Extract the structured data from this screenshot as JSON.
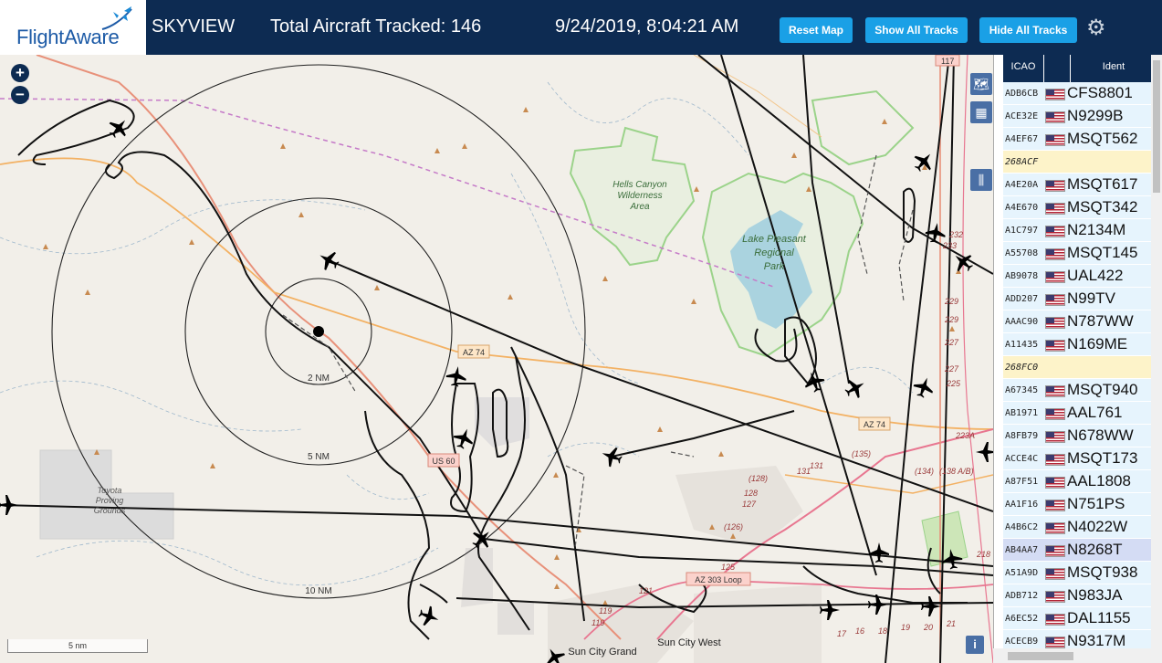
{
  "header": {
    "logo_text": "FlightAware",
    "app_name": "SKYVIEW",
    "aircraft_tracked": "Total Aircraft Tracked: 146",
    "datetime": "9/24/2019, 8:04:21 AM",
    "buttons": {
      "reset_map": "Reset Map",
      "show_all_tracks": "Show All Tracks",
      "hide_all_tracks": "Hide All Tracks"
    }
  },
  "map": {
    "zoom_in": "+",
    "zoom_out": "−",
    "range_rings": [
      "2 NM",
      "5 NM",
      "10 NM"
    ],
    "scale_label": "5 nm",
    "info": "i",
    "labels": {
      "hells_canyon": [
        "Hells Canyon",
        "Wilderness",
        "Area"
      ],
      "lake_pleasant": [
        "Lake Pleasant",
        "Regional",
        "Park"
      ],
      "toyota": [
        "Toyota",
        "Proving",
        "Grounds"
      ],
      "sun_city_grand": "Sun City Grand",
      "sun_city_west": "Sun City West",
      "road_az74_a": "AZ 74",
      "road_az74_b": "AZ 74",
      "road_us60": "US 60",
      "road_az303": "AZ 303 Loop",
      "nums": [
        "229",
        "229",
        "227",
        "227",
        "225",
        "223A",
        "(135)",
        "(134)",
        "(138 A/B)",
        "131",
        "131",
        "(128)",
        "128",
        "127",
        "(126)",
        "125",
        "121",
        "119",
        "119",
        "17",
        "16",
        "18",
        "19",
        "20",
        "21",
        "218",
        "232",
        "233",
        "117"
      ]
    }
  },
  "table": {
    "headers": {
      "icao": "ICAO",
      "flag": "",
      "ident": "Ident"
    },
    "rows": [
      {
        "icao": "ADB6CB",
        "ident": "CFS8801",
        "flag": true,
        "state": "normal"
      },
      {
        "icao": "ACE32E",
        "ident": "N9299B",
        "flag": true,
        "state": "normal"
      },
      {
        "icao": "A4EF67",
        "ident": "MSQT562",
        "flag": true,
        "state": "normal"
      },
      {
        "icao": "268ACF",
        "ident": "",
        "flag": false,
        "state": "highlight"
      },
      {
        "icao": "A4E20A",
        "ident": "MSQT617",
        "flag": true,
        "state": "normal"
      },
      {
        "icao": "A4E670",
        "ident": "MSQT342",
        "flag": true,
        "state": "normal"
      },
      {
        "icao": "A1C797",
        "ident": "N2134M",
        "flag": true,
        "state": "normal"
      },
      {
        "icao": "A55708",
        "ident": "MSQT145",
        "flag": true,
        "state": "normal"
      },
      {
        "icao": "AB9078",
        "ident": "UAL422",
        "flag": true,
        "state": "normal"
      },
      {
        "icao": "ADD207",
        "ident": "N99TV",
        "flag": true,
        "state": "normal"
      },
      {
        "icao": "AAAC90",
        "ident": "N787WW",
        "flag": true,
        "state": "normal"
      },
      {
        "icao": "A11435",
        "ident": "N169ME",
        "flag": true,
        "state": "normal"
      },
      {
        "icao": "268FC0",
        "ident": "",
        "flag": false,
        "state": "highlight"
      },
      {
        "icao": "A67345",
        "ident": "MSQT940",
        "flag": true,
        "state": "normal"
      },
      {
        "icao": "AB1971",
        "ident": "AAL761",
        "flag": true,
        "state": "normal"
      },
      {
        "icao": "A8FB79",
        "ident": "N678WW",
        "flag": true,
        "state": "normal"
      },
      {
        "icao": "ACCE4C",
        "ident": "MSQT173",
        "flag": true,
        "state": "normal"
      },
      {
        "icao": "A87F51",
        "ident": "AAL1808",
        "flag": true,
        "state": "normal"
      },
      {
        "icao": "AA1F16",
        "ident": "N751PS",
        "flag": true,
        "state": "normal"
      },
      {
        "icao": "A4B6C2",
        "ident": "N4022W",
        "flag": true,
        "state": "normal"
      },
      {
        "icao": "AB4AA7",
        "ident": "N8268T",
        "flag": true,
        "state": "selected"
      },
      {
        "icao": "A51A9D",
        "ident": "MSQT938",
        "flag": true,
        "state": "normal"
      },
      {
        "icao": "ADB712",
        "ident": "N983JA",
        "flag": true,
        "state": "normal"
      },
      {
        "icao": "A6EC52",
        "ident": "DAL1155",
        "flag": true,
        "state": "normal"
      },
      {
        "icao": "ACECB9",
        "ident": "N9317M",
        "flag": true,
        "state": "normal"
      }
    ]
  },
  "colors": {
    "header_bg": "#0d2b52",
    "button_bg": "#1aa0e6",
    "row_bg": "#e6f4fd",
    "row_highlight": "#fdf3c9",
    "row_selected": "#d4dcf4",
    "map_bg": "#f2efe9",
    "water": "#aad3df",
    "park_outline": "#8fc97a"
  }
}
